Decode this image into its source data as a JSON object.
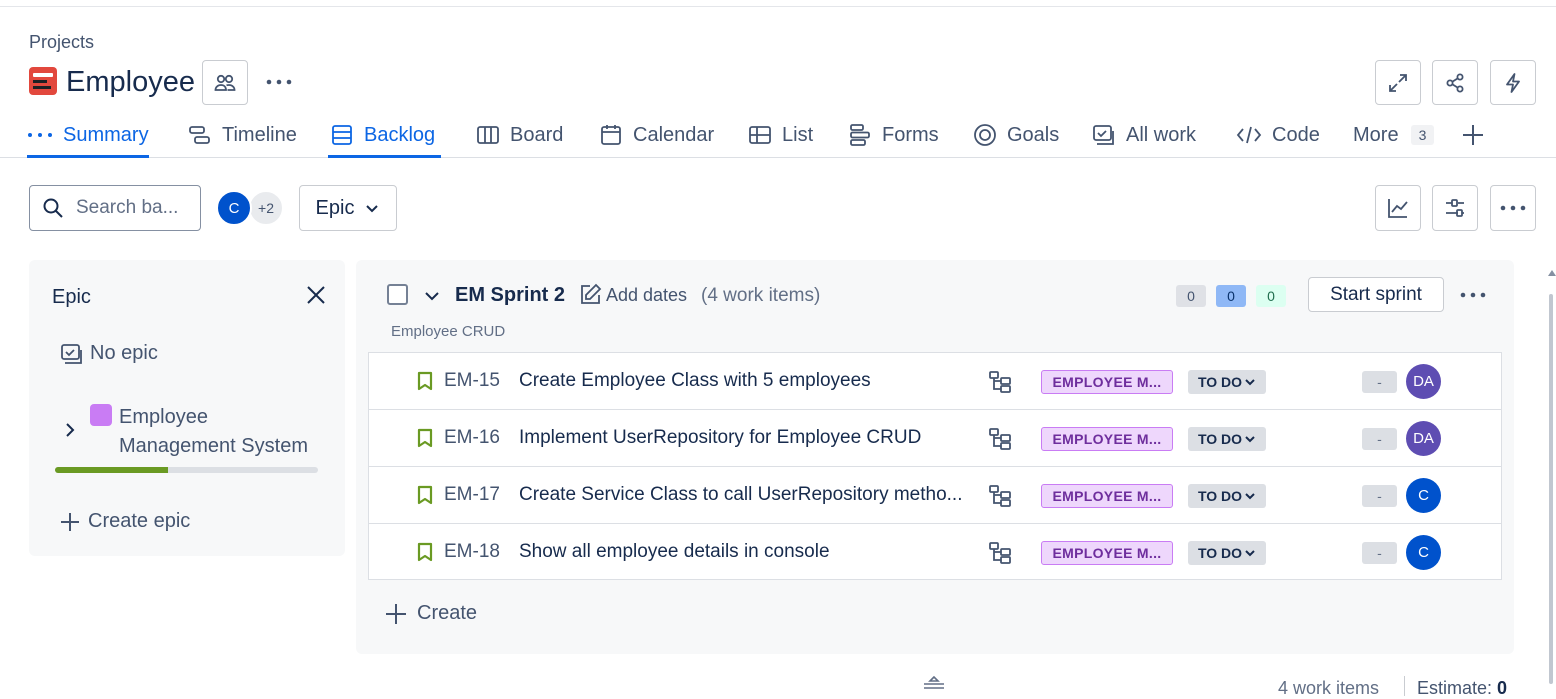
{
  "breadcrumb": "Projects",
  "project": {
    "name": "Employee"
  },
  "tabs": [
    {
      "label": "Summary",
      "icon": "dots-icon",
      "active": true
    },
    {
      "label": "Timeline",
      "icon": "timeline-icon"
    },
    {
      "label": "Backlog",
      "icon": "backlog-icon",
      "active": true
    },
    {
      "label": "Board",
      "icon": "board-icon"
    },
    {
      "label": "Calendar",
      "icon": "calendar-icon"
    },
    {
      "label": "List",
      "icon": "list-icon"
    },
    {
      "label": "Forms",
      "icon": "forms-icon"
    },
    {
      "label": "Goals",
      "icon": "goals-icon"
    },
    {
      "label": "All work",
      "icon": "all-work-icon"
    },
    {
      "label": "Code",
      "icon": "code-icon"
    },
    {
      "label": "More",
      "count": "3"
    }
  ],
  "toolbar": {
    "search_placeholder": "Search ba...",
    "avatar_letter": "C",
    "avatar_extra": "+2",
    "epic_filter": "Epic"
  },
  "epic_panel": {
    "title": "Epic",
    "no_epic": "No epic",
    "epic_name": "Employee Management System",
    "epic_color": "#c97cf4",
    "progress_done_fraction": 0.43,
    "create_label": "Create epic"
  },
  "sprint": {
    "name": "EM Sprint 2",
    "add_dates": "Add dates",
    "count": "(4 work items)",
    "goal": "Employee CRUD",
    "todo": "0",
    "in_progress": "0",
    "done": "0",
    "start_label": "Start sprint",
    "items": [
      {
        "key": "EM-15",
        "summary": "Create Employee Class with 5 employees",
        "epic": "EMPLOYEE M...",
        "status": "TO DO",
        "estimate": "-",
        "assignee": "DA",
        "assignee_color": "#5e4db2"
      },
      {
        "key": "EM-16",
        "summary": "Implement UserRepository for Employee CRUD",
        "epic": "EMPLOYEE M...",
        "status": "TO DO",
        "estimate": "-",
        "assignee": "DA",
        "assignee_color": "#5e4db2"
      },
      {
        "key": "EM-17",
        "summary": "Create Service Class to call UserRepository metho...",
        "epic": "EMPLOYEE M...",
        "status": "TO DO",
        "estimate": "-",
        "assignee": "C",
        "assignee_color": "#0052cc"
      },
      {
        "key": "EM-18",
        "summary": "Show all employee details in console",
        "epic": "EMPLOYEE M...",
        "status": "TO DO",
        "estimate": "-",
        "assignee": "C",
        "assignee_color": "#0052cc"
      }
    ],
    "create_label": "Create"
  },
  "footer": {
    "count": "4 work items",
    "estimate_label": "Estimate:",
    "estimate_value": "0"
  }
}
